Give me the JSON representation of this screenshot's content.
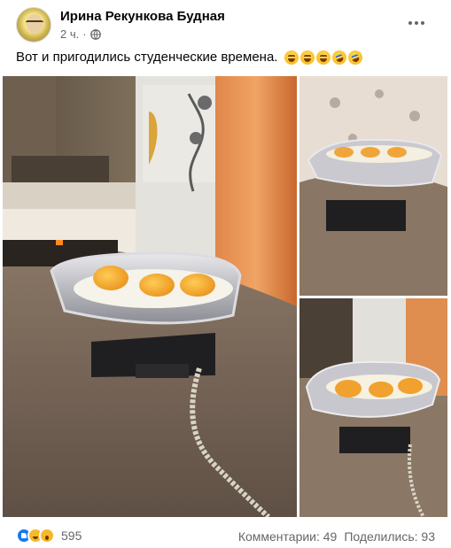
{
  "post": {
    "author": "Ирина Рекункова Будная",
    "time": "2 ч.",
    "dot": "·",
    "text": "Вот и пригодились студенческие времена."
  },
  "icons": {
    "more": "more-options-icon",
    "privacy": "globe-icon",
    "text_emojis": [
      "grinning-squinting-emoji",
      "grinning-squinting-emoji",
      "grinning-squinting-emoji",
      "rolling-laughing-emoji",
      "rolling-laughing-emoji"
    ],
    "reactions": [
      "like-icon",
      "haha-icon",
      "wow-icon"
    ]
  },
  "engagement": {
    "reaction_count": "595",
    "comments": "Комментарии: 49",
    "shares": "Поделились: 93"
  },
  "photos": [
    {
      "label": "egg-iron-main-photo"
    },
    {
      "label": "egg-iron-side-photo"
    },
    {
      "label": "egg-iron-closeup-photo"
    }
  ],
  "colors": {
    "text": "#050505",
    "secondary": "#65676b",
    "like_blue": "#1877f2",
    "reaction_yellow": "#f7b928"
  }
}
